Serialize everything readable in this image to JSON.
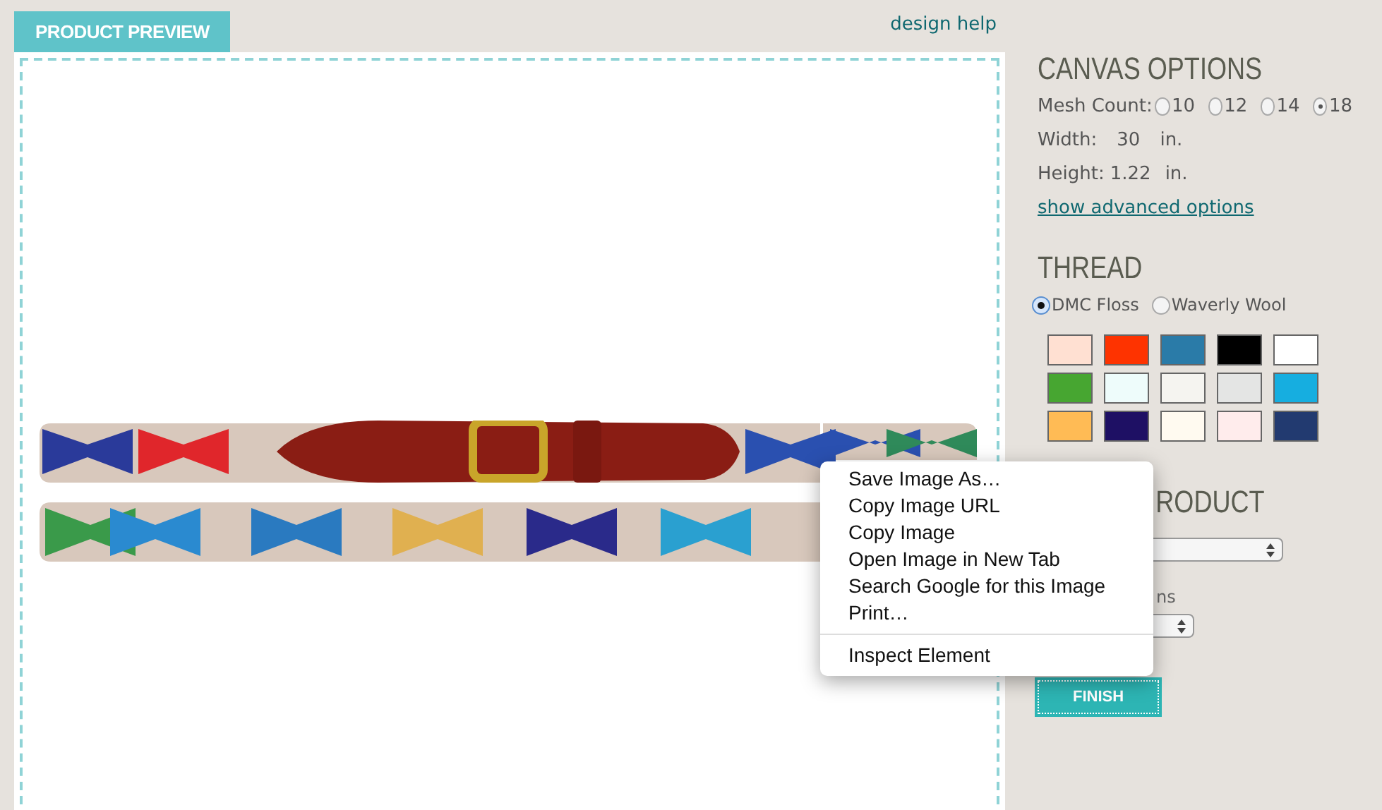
{
  "preview": {
    "tab": "PRODUCT PREVIEW",
    "help_link": "design help"
  },
  "canvas_options": {
    "title": "CANVAS OPTIONS",
    "mesh_label": "Mesh Count:",
    "mesh_counts": [
      {
        "label": "10",
        "selected": false
      },
      {
        "label": "12",
        "selected": false
      },
      {
        "label": "14",
        "selected": false
      },
      {
        "label": "18",
        "selected": true
      }
    ],
    "width_label": "Width:",
    "width_value": "30",
    "width_unit": "in.",
    "height_label": "Height:",
    "height_value": "1.22",
    "height_unit": "in.",
    "advanced_link": "show advanced options"
  },
  "thread": {
    "title": "THREAD",
    "types": [
      {
        "label": "DMC Floss",
        "selected": true
      },
      {
        "label": "Waverly Wool",
        "selected": false
      }
    ],
    "swatches": [
      {
        "color": "#ffe0d2"
      },
      {
        "color": "#fe3300"
      },
      {
        "color": "#2a7ba8"
      },
      {
        "color": "#000000"
      },
      {
        "color": "#ffffff"
      },
      {
        "color": "#47a631"
      },
      {
        "color": "#eefcfb"
      },
      {
        "color": "#f5f4f0"
      },
      {
        "color": "#e4e5e4"
      },
      {
        "color": "#16aee0"
      },
      {
        "color": "#ffbb55"
      },
      {
        "color": "#1e1064"
      },
      {
        "color": "#fffaf0"
      },
      {
        "color": "#ffecec"
      },
      {
        "color": "#223a70"
      }
    ]
  },
  "create_product": {
    "title": "RODUCT",
    "options_label": "ns",
    "finish": "FINISH"
  },
  "context_menu": {
    "items": [
      {
        "label": "Save Image As…",
        "kind": "item"
      },
      {
        "label": "Copy Image URL",
        "kind": "item"
      },
      {
        "label": "Copy Image",
        "kind": "item"
      },
      {
        "label": "Open Image in New Tab",
        "kind": "item"
      },
      {
        "label": "Search Google for this Image",
        "kind": "item"
      },
      {
        "label": "Print…",
        "kind": "item"
      },
      {
        "kind": "separator"
      },
      {
        "label": "Inspect Element",
        "kind": "item"
      }
    ]
  }
}
